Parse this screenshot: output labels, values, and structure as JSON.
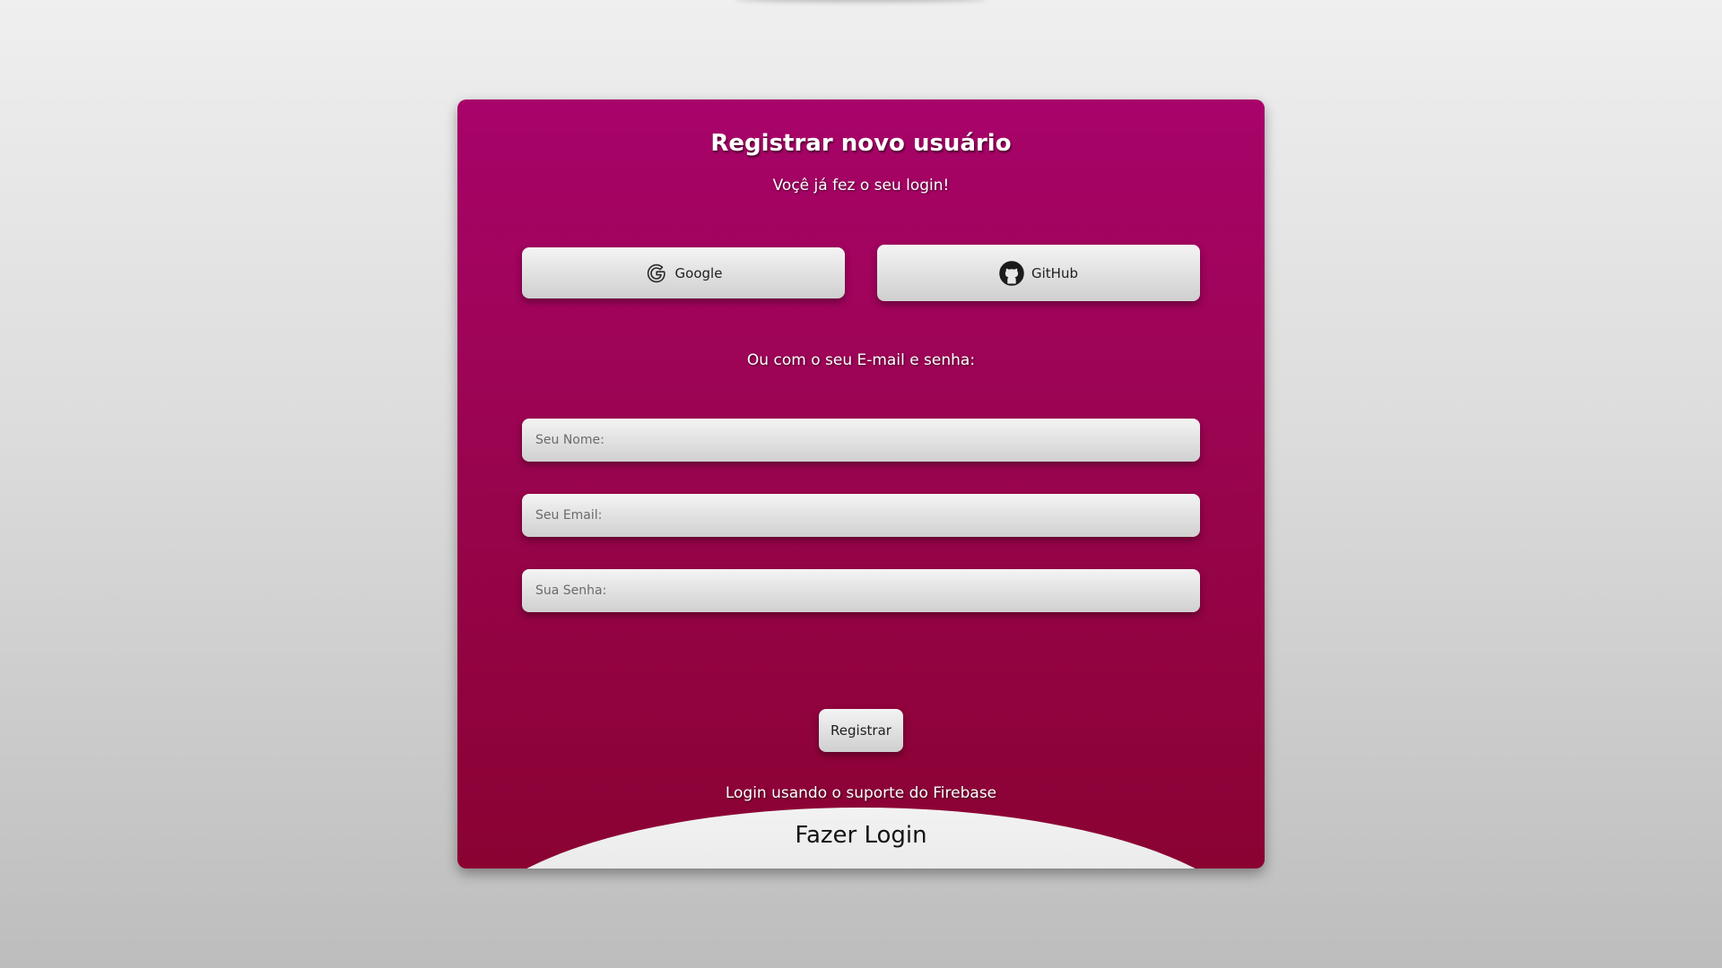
{
  "page": {
    "background_top": "#efefef",
    "background_bottom": "#bdbdbd"
  },
  "card": {
    "accent_top": "#a8036a",
    "accent_bottom": "#8a0232",
    "title": "Registrar novo usuário",
    "subtitle": "Voçê já fez o seu login!",
    "social": {
      "google_label": "Google",
      "google_icon": "google-icon",
      "github_label": "GitHub",
      "github_icon": "github-icon"
    },
    "or_text": "Ou com o seu E-mail e senha:",
    "fields": {
      "name_placeholder": "Seu Nome:",
      "email_placeholder": "Seu Email:",
      "password_placeholder": "Sua Senha:"
    },
    "submit_label": "Registrar",
    "firebase_text": "Login usando o suporte do Firebase",
    "login_link": "Fazer Login"
  }
}
